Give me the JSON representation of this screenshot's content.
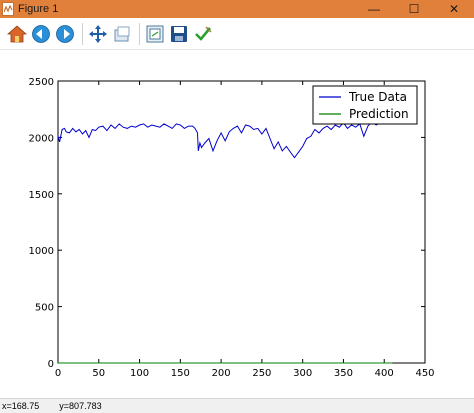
{
  "window": {
    "title": "Figure 1",
    "minimize_glyph": "—",
    "maximize_glyph": "☐",
    "close_glyph": "✕"
  },
  "toolbar": {
    "buttons": [
      {
        "name": "home-icon",
        "color": "#d9652b"
      },
      {
        "name": "back-icon",
        "color": "#2a8fd6"
      },
      {
        "name": "forward-icon",
        "color": "#2a8fd6"
      },
      {
        "name": "pan-icon",
        "color": "#1f5fa8"
      },
      {
        "name": "zoom-icon",
        "color": "#6a8fb5"
      },
      {
        "name": "configure-subplots-icon",
        "color": "#4a7a9a"
      },
      {
        "name": "save-icon",
        "color": "#1f4f8a"
      },
      {
        "name": "edit-check-icon",
        "color": "#2aa02a"
      }
    ]
  },
  "status": {
    "x_readout": "x=168.75",
    "y_readout": "y=807.783"
  },
  "chart_data": {
    "type": "line",
    "xlim": [
      0,
      450
    ],
    "ylim": [
      0,
      2500
    ],
    "xticks": [
      "0",
      "50",
      "100",
      "150",
      "200",
      "250",
      "300",
      "350",
      "400",
      "450"
    ],
    "yticks": [
      "0",
      "500",
      "1000",
      "1500",
      "2000",
      "2500"
    ],
    "grid": false,
    "legend_position": "top-right",
    "series": [
      {
        "name": "True Data",
        "color": "#0000cc",
        "x": [
          0,
          2,
          5,
          8,
          10,
          14,
          18,
          22,
          26,
          30,
          34,
          38,
          42,
          46,
          50,
          55,
          60,
          65,
          70,
          75,
          80,
          85,
          90,
          95,
          100,
          105,
          110,
          115,
          120,
          125,
          130,
          135,
          140,
          145,
          150,
          155,
          160,
          165,
          168,
          171,
          172,
          174,
          176,
          180,
          185,
          190,
          195,
          200,
          205,
          210,
          215,
          220,
          225,
          230,
          235,
          240,
          245,
          250,
          255,
          260,
          265,
          270,
          275,
          280,
          285,
          290,
          295,
          300,
          305,
          310,
          315,
          320,
          325,
          330,
          335,
          340,
          345,
          350,
          355,
          360,
          365,
          370,
          375,
          380,
          385,
          390,
          395,
          400
        ],
        "y": [
          2010,
          1960,
          2070,
          2080,
          2050,
          2040,
          2080,
          2050,
          2070,
          2030,
          2060,
          2000,
          2070,
          2060,
          2090,
          2100,
          2060,
          2110,
          2080,
          2120,
          2090,
          2080,
          2100,
          2090,
          2110,
          2120,
          2090,
          2110,
          2100,
          2090,
          2120,
          2100,
          2080,
          2120,
          2110,
          2080,
          2100,
          2100,
          2080,
          2040,
          1880,
          1950,
          1910,
          1950,
          1990,
          1880,
          1970,
          2040,
          1970,
          2050,
          2080,
          2100,
          2040,
          2110,
          2100,
          2070,
          2080,
          2030,
          2080,
          1990,
          1900,
          1960,
          1880,
          1920,
          1870,
          1820,
          1870,
          1920,
          1990,
          2010,
          2070,
          2040,
          2080,
          2100,
          2070,
          2110,
          2090,
          2130,
          2080,
          2110,
          2090,
          2120,
          2010,
          2100,
          2140,
          2110,
          2130,
          2120
        ]
      },
      {
        "name": "Prediction",
        "color": "#008000",
        "x": [
          0,
          410
        ],
        "y": [
          0,
          0
        ]
      }
    ]
  }
}
